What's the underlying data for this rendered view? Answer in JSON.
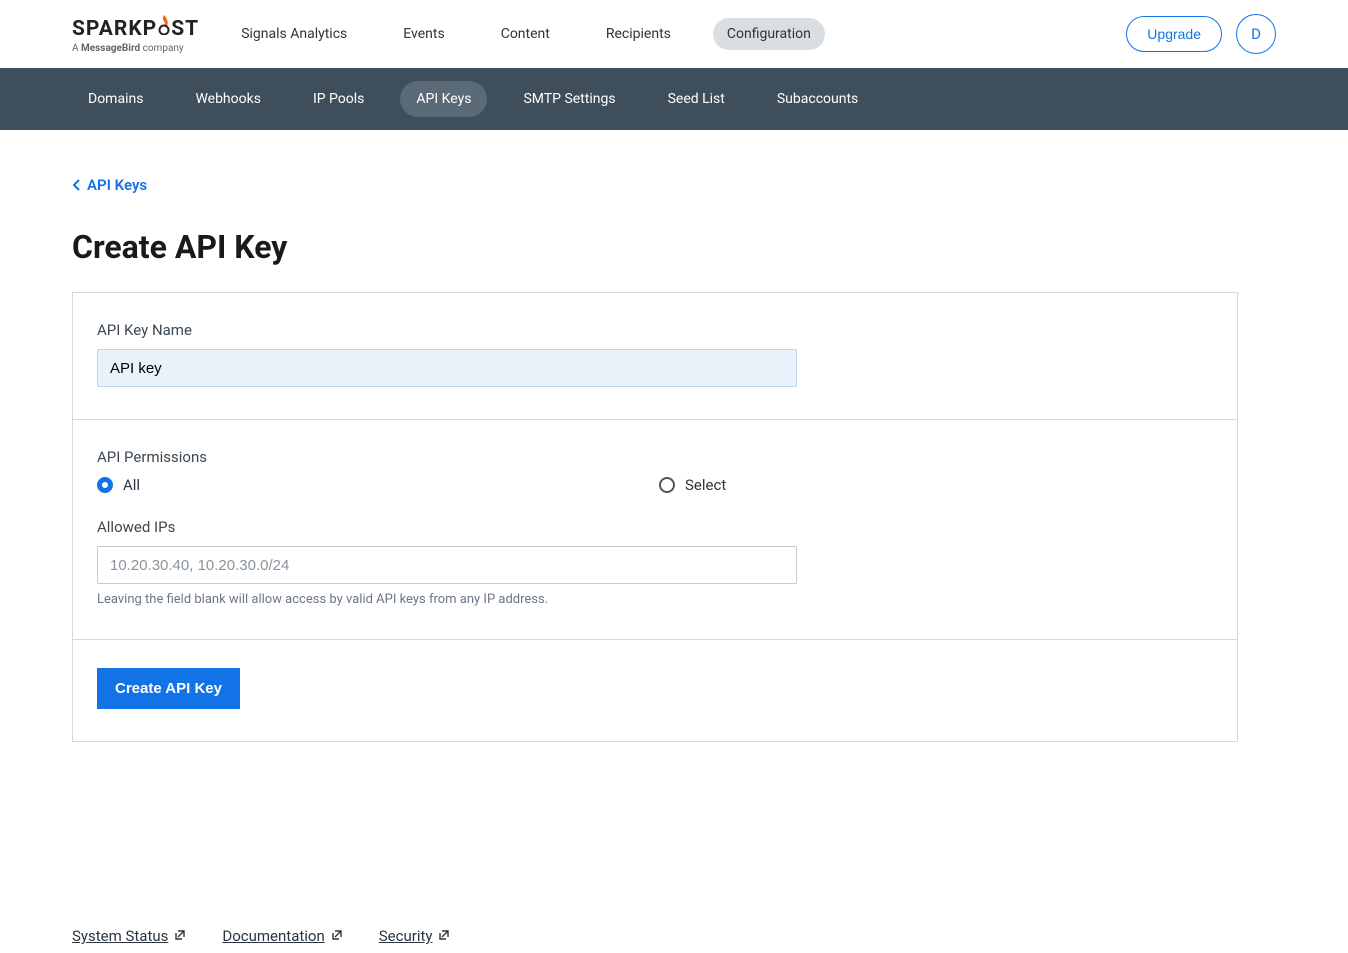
{
  "brand": {
    "name_left": "SPARKP",
    "name_right": "ST",
    "tagline_prefix": "A ",
    "tagline_bold": "MessageBird",
    "tagline_suffix": " company"
  },
  "mainNav": {
    "items": [
      {
        "label": "Signals Analytics",
        "active": false
      },
      {
        "label": "Events",
        "active": false
      },
      {
        "label": "Content",
        "active": false
      },
      {
        "label": "Recipients",
        "active": false
      },
      {
        "label": "Configuration",
        "active": true
      }
    ]
  },
  "header": {
    "upgrade_label": "Upgrade",
    "avatar_initial": "D"
  },
  "subNav": {
    "items": [
      {
        "label": "Domains",
        "active": false
      },
      {
        "label": "Webhooks",
        "active": false
      },
      {
        "label": "IP Pools",
        "active": false
      },
      {
        "label": "API Keys",
        "active": true
      },
      {
        "label": "SMTP Settings",
        "active": false
      },
      {
        "label": "Seed List",
        "active": false
      },
      {
        "label": "Subaccounts",
        "active": false
      }
    ]
  },
  "breadcrumb": {
    "label": "API Keys"
  },
  "page": {
    "title": "Create API Key"
  },
  "form": {
    "name_label": "API Key Name",
    "name_value": "API key",
    "permissions_label": "API Permissions",
    "permissions_options": {
      "all": "All",
      "select": "Select"
    },
    "permissions_selected": "all",
    "allowed_ips_label": "Allowed IPs",
    "allowed_ips_placeholder": "10.20.30.40, 10.20.30.0/24",
    "allowed_ips_help": "Leaving the field blank will allow access by valid API keys from any IP address.",
    "submit_label": "Create API Key"
  },
  "footer": {
    "links": [
      {
        "label": "System Status"
      },
      {
        "label": "Documentation"
      },
      {
        "label": "Security"
      }
    ]
  },
  "colors": {
    "accent": "#1273e6",
    "subnav_bg": "#3f4e5b",
    "flame": "#fa6423"
  }
}
